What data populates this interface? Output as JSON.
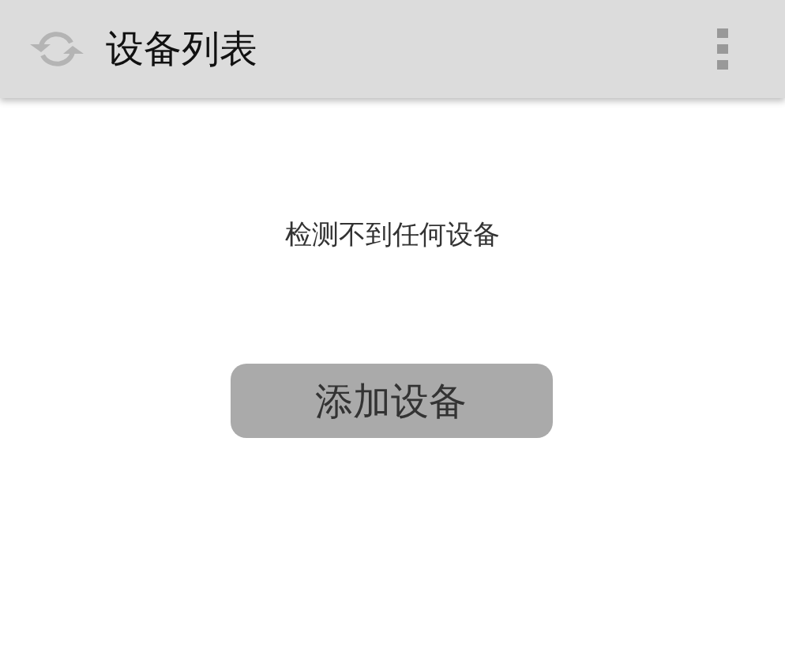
{
  "app_bar": {
    "title": "设备列表"
  },
  "empty_message": "检测不到任何设备",
  "add_button": {
    "label": "添加设备"
  }
}
